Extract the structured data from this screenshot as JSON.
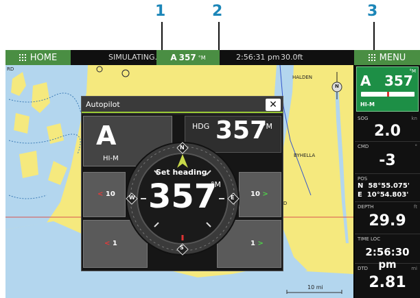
{
  "callouts": {
    "one": "1",
    "two": "2",
    "three": "3"
  },
  "topbar": {
    "home_label": "HOME",
    "menu_label": "MENU",
    "status": "SIMULATING...",
    "heading_mode": "A",
    "heading_value": "357",
    "heading_unit": "°M",
    "time": "2:56:31 pm",
    "depth": "30.0ft"
  },
  "chart": {
    "places": {
      "halden": "HALDEN",
      "byhella": "BYHELLA",
      "rd_left": "RD",
      "rd_mid": "RD"
    },
    "scale": "10 mi",
    "north": "N"
  },
  "autopilot": {
    "title": "Autopilot",
    "mode": "A",
    "mode_sub": "HI-M",
    "hdg_label": "HDG",
    "hdg_value": "357",
    "hdg_unit": "°M",
    "set_heading_label": "Set heading",
    "dial_value": "357",
    "dial_unit": "°M",
    "compass": {
      "n": "N",
      "e": "E",
      "s": "S",
      "w": "W"
    },
    "port_10": "10",
    "stbd_10": "10",
    "port_1": "1",
    "stbd_1": "1"
  },
  "panel": {
    "ap_mode": "A",
    "ap_value": "357",
    "ap_unit": "°M",
    "ap_sub": "HI-M",
    "sog_label": "SOG",
    "sog_unit": "kn",
    "sog_value": "2.0",
    "cmd_label": "CMD",
    "cmd_unit": "°",
    "cmd_value": "-3",
    "pos_label": "POS",
    "pos_lat": "N  58°55.075'",
    "pos_lon": "E  10°54.803'",
    "depth_label": "DEPTH",
    "depth_unit": "ft",
    "depth_value": "29.9",
    "time_label": "TIME LOC",
    "time_value": "2:56:30 pm",
    "dtd_label": "DTD",
    "dtd_unit": "mi",
    "dtd_value": "2.81"
  },
  "colors": {
    "accent_green": "#4a8e43",
    "ap_green": "#1d8f46",
    "callout_blue": "#1c86b8",
    "sea": "#f5e97e",
    "water": "#b3d6ee"
  }
}
